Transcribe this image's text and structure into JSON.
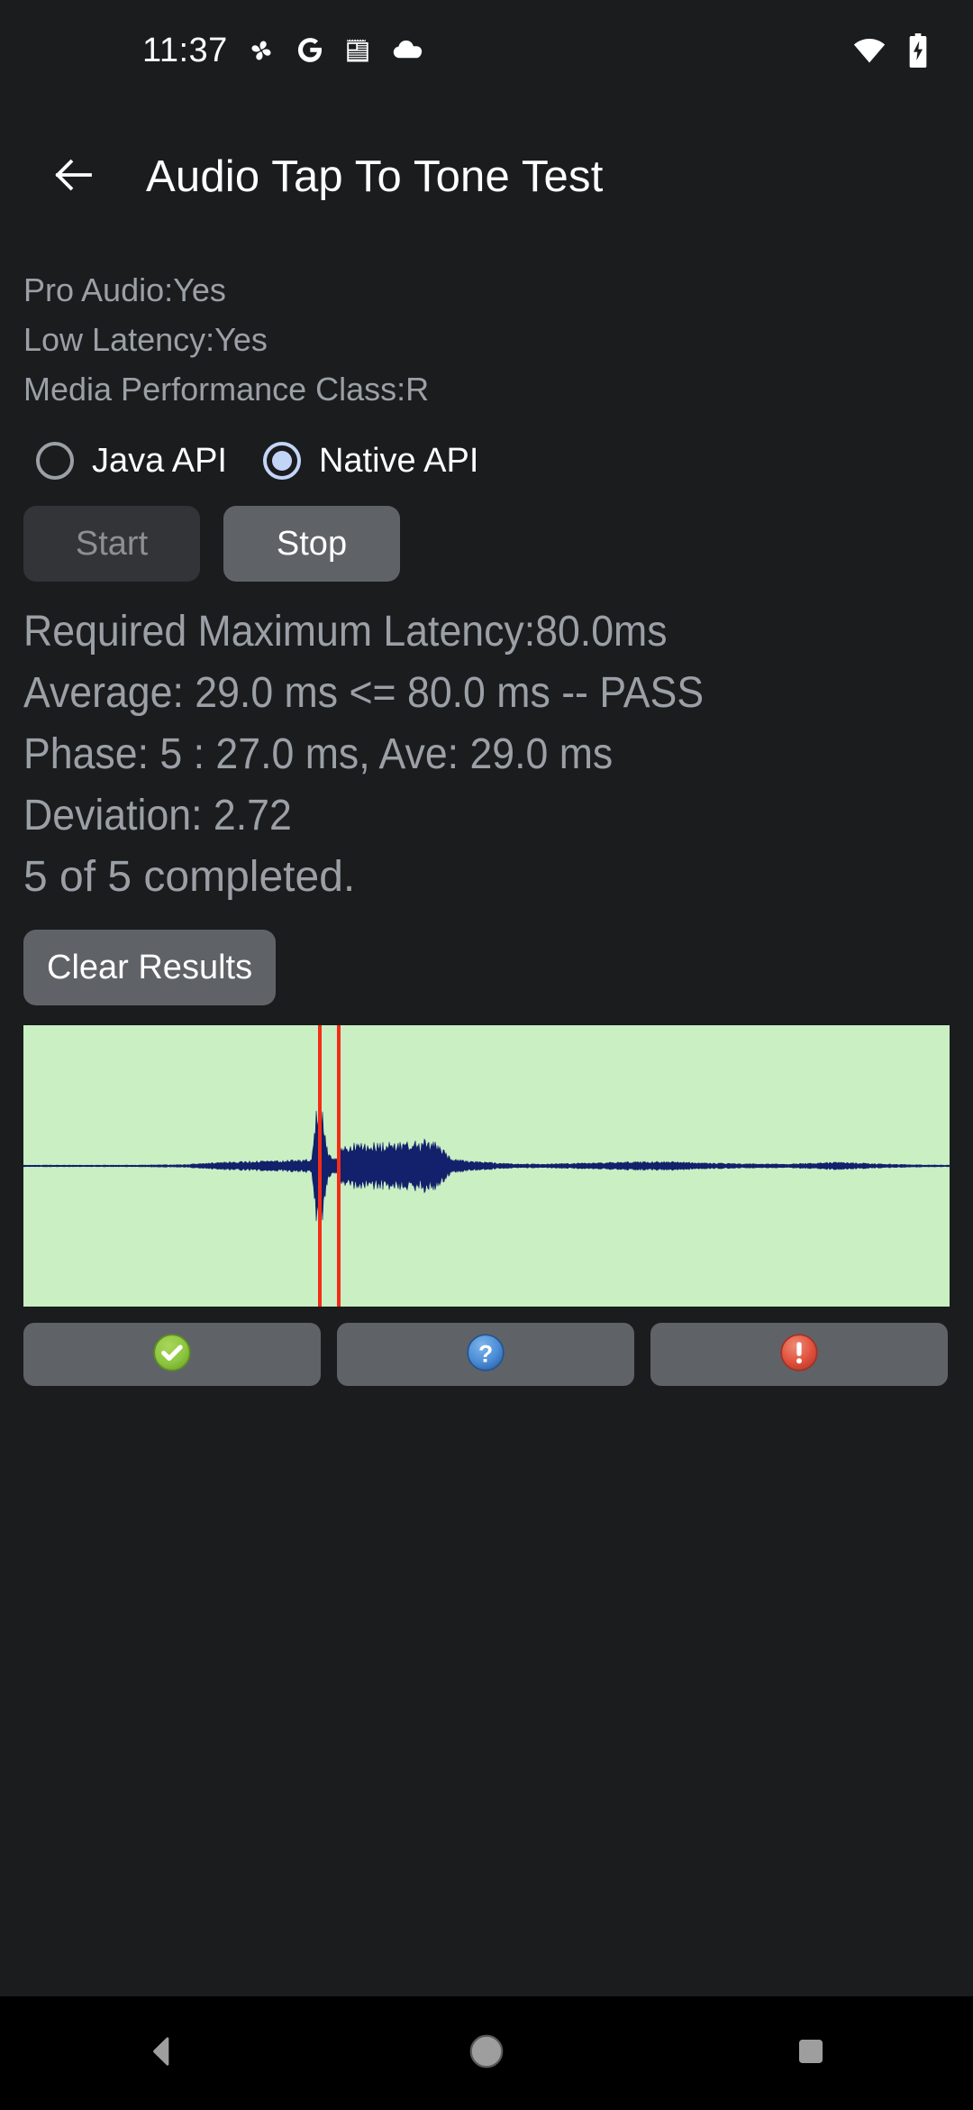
{
  "status_bar": {
    "clock": "11:37",
    "left_icons": [
      {
        "name": "pinwheel-icon",
        "glyph": "pinwheel"
      },
      {
        "name": "google-icon",
        "glyph": "G"
      },
      {
        "name": "calendar-note-icon",
        "glyph": "note"
      },
      {
        "name": "cloud-icon",
        "glyph": "cloud"
      }
    ],
    "right_icons": [
      {
        "name": "wifi-icon",
        "glyph": "wifi"
      },
      {
        "name": "battery-charging-icon",
        "glyph": "battery-charging"
      }
    ]
  },
  "app_bar": {
    "back_label": "Back",
    "title": "Audio Tap To Tone Test"
  },
  "device_info": {
    "pro_audio": "Pro Audio:Yes",
    "low_latency": "Low Latency:Yes",
    "media_performance_class": "Media Performance Class:R"
  },
  "api_selector": {
    "options": [
      {
        "label": "Java API",
        "selected": false
      },
      {
        "label": "Native API",
        "selected": true
      }
    ]
  },
  "controls": {
    "start_label": "Start",
    "start_enabled": false,
    "stop_label": "Stop",
    "stop_enabled": true,
    "clear_label": "Clear Results"
  },
  "results": {
    "lines": [
      "Required Maximum Latency:80.0ms",
      "Average: 29.0 ms <= 80.0 ms -- PASS",
      "Phase: 5 : 27.0 ms, Ave: 29.0 ms",
      "Deviation: 2.72",
      "5 of 5 completed."
    ],
    "required_maximum_latency_ms": 80.0,
    "average_ms": 29.0,
    "verdict": "PASS",
    "phase": 5,
    "phase_latency_ms": 27.0,
    "deviation": 2.72,
    "completed": "5 of 5"
  },
  "verdict_buttons": [
    {
      "name": "pass-button",
      "icon": "check-circle-icon",
      "color": "#8CC63F"
    },
    {
      "name": "info-button",
      "icon": "question-circle-icon",
      "color": "#4A8CD6"
    },
    {
      "name": "fail-button",
      "icon": "exclamation-circle-icon",
      "color": "#E0513C"
    }
  ],
  "nav_bar": {
    "back": "back-triangle-icon",
    "home": "home-circle-icon",
    "recents": "recents-square-icon"
  },
  "chart_data": {
    "type": "line",
    "title": "",
    "xlabel": "",
    "ylabel": "",
    "background_color": "#C9EFC3",
    "trace_color": "#13206B",
    "cursor_color": "#F42C16",
    "grid": false,
    "legend": null,
    "xlim": [
      0,
      1028
    ],
    "ylim": [
      -1,
      1
    ],
    "baseline_y": 0,
    "cursors": [
      {
        "name": "tap-cursor",
        "x": 327
      },
      {
        "name": "tone-cursor",
        "x": 348
      }
    ],
    "series": [
      {
        "name": "audio-waveform",
        "envelope": [
          {
            "x": 0,
            "amp": 0.006
          },
          {
            "x": 120,
            "amp": 0.006
          },
          {
            "x": 180,
            "amp": 0.01
          },
          {
            "x": 215,
            "amp": 0.028
          },
          {
            "x": 250,
            "amp": 0.035
          },
          {
            "x": 290,
            "amp": 0.04
          },
          {
            "x": 320,
            "amp": 0.05
          },
          {
            "x": 325,
            "amp": 0.47
          },
          {
            "x": 330,
            "amp": 0.48
          },
          {
            "x": 334,
            "amp": 0.3
          },
          {
            "x": 338,
            "amp": 0.09
          },
          {
            "x": 344,
            "amp": 0.055
          },
          {
            "x": 349,
            "amp": 0.06
          },
          {
            "x": 352,
            "amp": 0.15
          },
          {
            "x": 360,
            "amp": 0.165
          },
          {
            "x": 400,
            "amp": 0.17
          },
          {
            "x": 430,
            "amp": 0.175
          },
          {
            "x": 448,
            "amp": 0.195
          },
          {
            "x": 452,
            "amp": 0.175
          },
          {
            "x": 462,
            "amp": 0.17
          },
          {
            "x": 468,
            "amp": 0.1
          },
          {
            "x": 474,
            "amp": 0.06
          },
          {
            "x": 486,
            "amp": 0.045
          },
          {
            "x": 510,
            "amp": 0.03
          },
          {
            "x": 545,
            "amp": 0.016
          },
          {
            "x": 570,
            "amp": 0.014
          },
          {
            "x": 600,
            "amp": 0.018
          },
          {
            "x": 640,
            "amp": 0.024
          },
          {
            "x": 680,
            "amp": 0.032
          },
          {
            "x": 700,
            "amp": 0.034
          },
          {
            "x": 730,
            "amp": 0.03
          },
          {
            "x": 760,
            "amp": 0.022
          },
          {
            "x": 800,
            "amp": 0.016
          },
          {
            "x": 850,
            "amp": 0.014
          },
          {
            "x": 890,
            "amp": 0.026
          },
          {
            "x": 910,
            "amp": 0.028
          },
          {
            "x": 940,
            "amp": 0.018
          },
          {
            "x": 980,
            "amp": 0.01
          },
          {
            "x": 1028,
            "amp": 0.006
          }
        ]
      }
    ]
  }
}
